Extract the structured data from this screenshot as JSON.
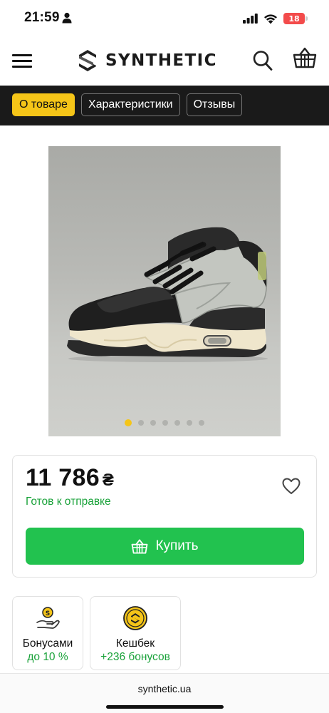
{
  "status_bar": {
    "time": "21:59",
    "battery": "18"
  },
  "header": {
    "logo_text": "SYNTHETIC",
    "icons": [
      "menu-icon",
      "search-icon",
      "basket-icon"
    ]
  },
  "tabs": [
    {
      "label": "О товаре",
      "active": true
    },
    {
      "label": "Характеристики",
      "active": false
    },
    {
      "label": "Отзывы",
      "active": false
    }
  ],
  "gallery": {
    "slides_total": 7,
    "active_slide": 1
  },
  "product": {
    "price": "11 786",
    "currency": "₴",
    "availability": "Готов к отправке",
    "buy_label": "Купить"
  },
  "bonuses": [
    {
      "title": "Бонусами",
      "sub": "до 10 %"
    },
    {
      "title": "Кешбек",
      "sub": "+236 бонусов"
    }
  ],
  "browser": {
    "url": "synthetic.ua"
  },
  "colors": {
    "accent_yellow": "#f5c518",
    "buy_green": "#22c24f",
    "available_green": "#1aa23a",
    "dark_bar": "#1a1a1a"
  }
}
